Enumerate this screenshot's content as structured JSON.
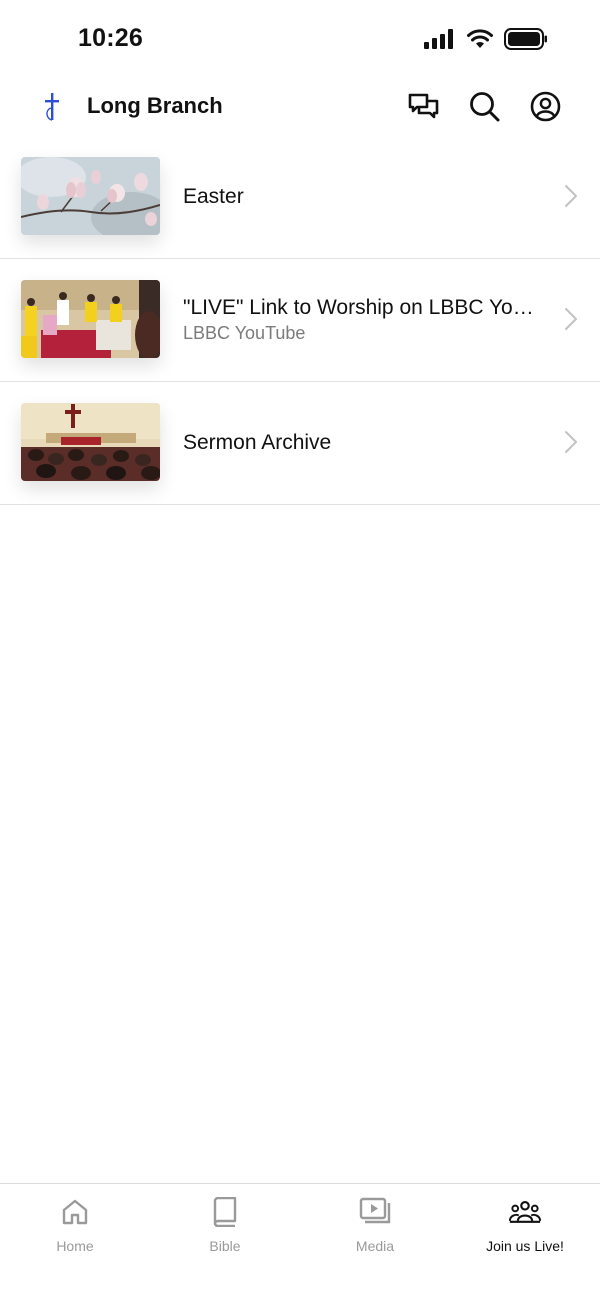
{
  "status_bar": {
    "time": "10:26"
  },
  "header": {
    "title": "Long Branch",
    "logo_icon": "cross-icon",
    "actions": [
      "chat-icon",
      "search-icon",
      "profile-icon"
    ]
  },
  "items": [
    {
      "title": "Easter",
      "subtitle": ""
    },
    {
      "title": "\"LIVE\" Link to Worship on LBBC YouTube",
      "subtitle": "LBBC YouTube"
    },
    {
      "title": "Sermon Archive",
      "subtitle": ""
    }
  ],
  "tabs": [
    {
      "label": "Home",
      "icon": "home-icon",
      "active": false
    },
    {
      "label": "Bible",
      "icon": "book-icon",
      "active": false
    },
    {
      "label": "Media",
      "icon": "media-icon",
      "active": false
    },
    {
      "label": "Join us Live!",
      "icon": "group-icon",
      "active": true
    }
  ],
  "colors": {
    "accent": "#111111",
    "logo_blue": "#2c4fd8",
    "inactive_tab": "#9a9a9a",
    "subtitle": "#7b7b7b"
  }
}
